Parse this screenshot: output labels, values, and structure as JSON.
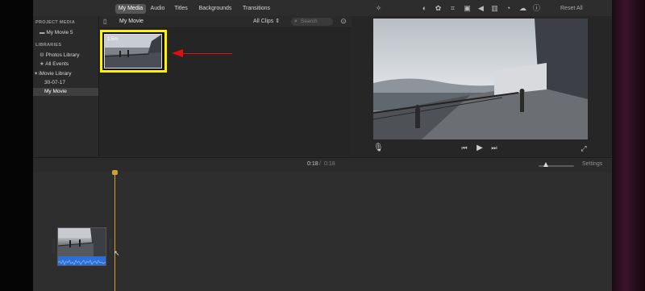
{
  "tabs": [
    {
      "label": "My Media",
      "active": true
    },
    {
      "label": "Audio",
      "active": false
    },
    {
      "label": "Titles",
      "active": false
    },
    {
      "label": "Backgrounds",
      "active": false
    },
    {
      "label": "Transitions",
      "active": false
    }
  ],
  "toolbar": {
    "reset_label": "Reset All",
    "icons": [
      "magic-wand-icon",
      "color-balance-icon",
      "color-correction-icon",
      "crop-icon",
      "stabilization-icon",
      "volume-icon",
      "noise-reduction-icon",
      "speed-icon",
      "clip-filter-icon",
      "info-icon"
    ]
  },
  "sidebar": {
    "project_heading": "PROJECT MEDIA",
    "project_item": "My Movie 5",
    "libraries_heading": "LIBRARIES",
    "items": [
      {
        "label": "Photos Library",
        "icon": "gear-icon"
      },
      {
        "label": "All Events",
        "icon": "star-icon"
      },
      {
        "label": "iMovie Library",
        "icon": "disclosure-icon"
      },
      {
        "label": "30-07-17"
      },
      {
        "label": "My Movie",
        "selected": true
      }
    ]
  },
  "browser": {
    "title": "My Movie",
    "filter": "All Clips",
    "search_placeholder": "Search",
    "clip_duration": "1.5m"
  },
  "viewer": {
    "mic_icon": "microphone-icon",
    "prev_icon": "skip-back-icon",
    "play_icon": "play-icon",
    "next_icon": "skip-forward-icon",
    "fullscreen_icon": "fullscreen-icon"
  },
  "timeline": {
    "current_time": "0:18",
    "separator": "/",
    "total_time": "0:18",
    "settings_label": "Settings"
  },
  "colors": {
    "highlight_frame": "#fff100",
    "annotation_arrow": "#e01010",
    "playhead": "#d2a22a",
    "audio_waveform": "#2d6fd8"
  }
}
